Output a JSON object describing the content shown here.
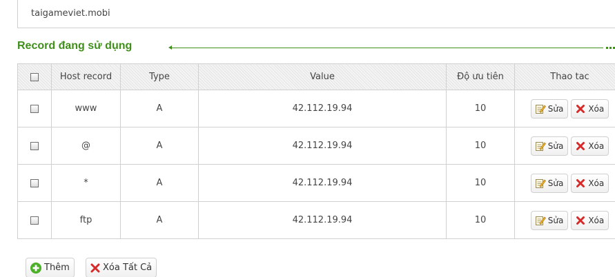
{
  "domain": "taigameviet.mobi",
  "section_title": "Record đang sử dụng",
  "table": {
    "headers": {
      "host": "Host record",
      "type": "Type",
      "value": "Value",
      "priority": "Độ ưu tiên",
      "actions": "Thao tac"
    },
    "rows": [
      {
        "host": "www",
        "type": "A",
        "value": "42.112.19.94",
        "priority": "10"
      },
      {
        "host": "@",
        "type": "A",
        "value": "42.112.19.94",
        "priority": "10"
      },
      {
        "host": "*",
        "type": "A",
        "value": "42.112.19.94",
        "priority": "10"
      },
      {
        "host": "ftp",
        "type": "A",
        "value": "42.112.19.94",
        "priority": "10"
      }
    ],
    "edit_label": "Sửa",
    "delete_label": "Xóa"
  },
  "buttons": {
    "add_label": "Thêm",
    "delete_all_label": "Xóa Tất Cả"
  },
  "colors": {
    "accent": "#3f8f1a",
    "delete_red": "#d42a2a",
    "add_green": "#4caf28"
  }
}
